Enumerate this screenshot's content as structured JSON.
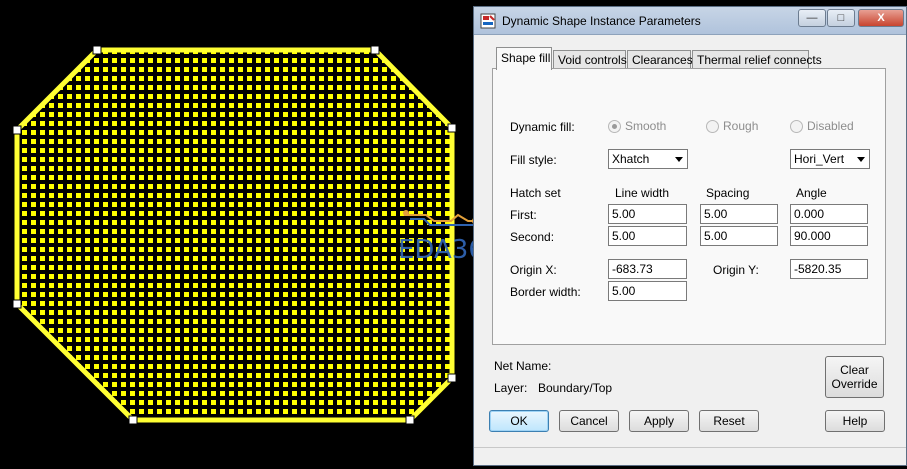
{
  "watermark": {
    "text": "EDA365"
  },
  "dialog": {
    "title": "Dynamic Shape Instance Parameters",
    "window_controls": {
      "minimize": "—",
      "maximize": "□",
      "close": "X"
    },
    "tabs": [
      {
        "label": "Shape fill",
        "active": true
      },
      {
        "label": "Void controls",
        "active": false
      },
      {
        "label": "Clearances",
        "active": false
      },
      {
        "label": "Thermal relief connects",
        "active": false
      }
    ],
    "dynamic_fill": {
      "label": "Dynamic fill:",
      "options": [
        {
          "label": "Smooth",
          "selected": true
        },
        {
          "label": "Rough",
          "selected": false
        },
        {
          "label": "Disabled",
          "selected": false
        }
      ]
    },
    "fill_style": {
      "label": "Fill style:",
      "value": "Xhatch",
      "pattern": "Hori_Vert"
    },
    "hatch": {
      "set_label": "Hatch set",
      "col_line_width": "Line width",
      "col_spacing": "Spacing",
      "col_angle": "Angle",
      "first": {
        "label": "First:",
        "line_width": "5.00",
        "spacing": "5.00",
        "angle": "0.000"
      },
      "second": {
        "label": "Second:",
        "line_width": "5.00",
        "spacing": "5.00",
        "angle": "90.000"
      }
    },
    "origin_x": {
      "label": "Origin X:",
      "value": "-683.73"
    },
    "origin_y": {
      "label": "Origin Y:",
      "value": "-5820.35"
    },
    "border_width": {
      "label": "Border width:",
      "value": "5.00"
    },
    "net_name": {
      "label": "Net Name:",
      "value": ""
    },
    "layer": {
      "label": "Layer:",
      "value": "Boundary/Top"
    },
    "buttons": {
      "clear_override": "Clear Override",
      "ok": "OK",
      "cancel": "Cancel",
      "apply": "Apply",
      "reset": "Reset",
      "help": "Help"
    }
  },
  "colors": {
    "shape_fill": "#ffff00",
    "hatch_lines": "#000000",
    "accent": "#3c7fb1",
    "watermark": "#2f63b0"
  }
}
